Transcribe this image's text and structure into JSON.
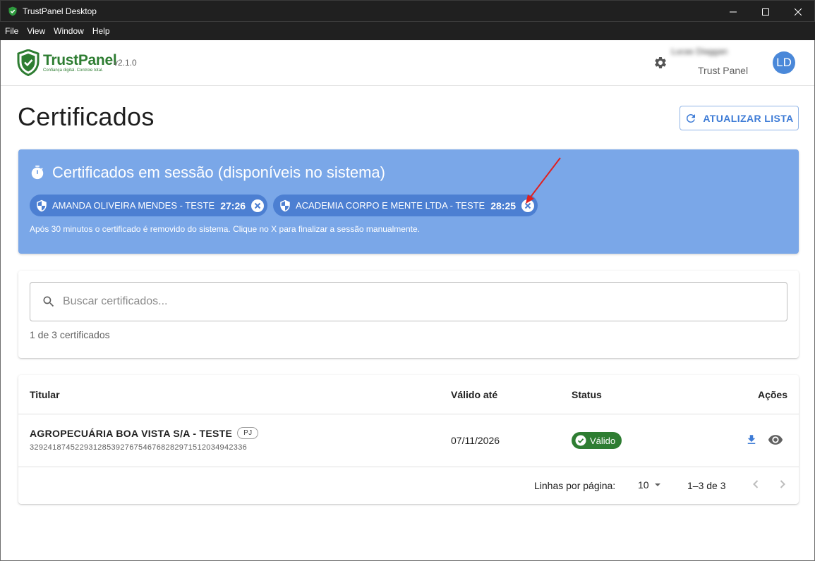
{
  "window": {
    "title": "TrustPanel Desktop",
    "menu": [
      "File",
      "View",
      "Window",
      "Help"
    ]
  },
  "header": {
    "logo_name": "TrustPanel",
    "logo_tagline": "Confiança digital. Controle total.",
    "version": "v2.1.0",
    "user_name": "Lucas Diaggan",
    "user_org": "Trust Panel",
    "avatar_initials": "LD"
  },
  "page": {
    "title": "Certificados",
    "refresh_label": "ATUALIZAR LISTA"
  },
  "session": {
    "title": "Certificados em sessão (disponíveis no sistema)",
    "chips": [
      {
        "label": "AMANDA OLIVEIRA MENDES - TESTE",
        "time": "27:26"
      },
      {
        "label": "ACADEMIA CORPO E MENTE LTDA - TESTE",
        "time": "28:25"
      }
    ],
    "note": "Após 30 minutos o certificado é removido do sistema. Clique no X para finalizar a sessão manualmente."
  },
  "search": {
    "placeholder": "Buscar certificados...",
    "count_text": "1 de 3 certificados"
  },
  "table": {
    "columns": [
      "Titular",
      "Válido até",
      "Status",
      "Ações"
    ],
    "rows": [
      {
        "name": "AGROPECUÁRIA BOA VISTA S/A - TESTE",
        "type_badge": "PJ",
        "id": "329241874522931285392767546768282971512034942336",
        "valid_until": "07/11/2026",
        "status": "Válido"
      }
    ],
    "rows_per_page_label": "Linhas por página:",
    "rows_per_page_value": "10",
    "range_text": "1–3 de 3"
  },
  "colors": {
    "brand_green": "#2e7d32",
    "accent_blue": "#3d7bd6",
    "session_bg": "#7aa7e8",
    "chip_bg": "#4c7fd2",
    "annotation_red": "#e02020"
  },
  "icons": [
    "shield-check-icon",
    "minimize-icon",
    "maximize-icon",
    "close-icon",
    "gear-icon",
    "refresh-icon",
    "stopwatch-icon",
    "shield-icon",
    "close-circle-icon",
    "search-icon",
    "check-circle-icon",
    "download-icon",
    "eye-icon",
    "chevron-down-icon",
    "chevron-left-icon",
    "chevron-right-icon"
  ]
}
